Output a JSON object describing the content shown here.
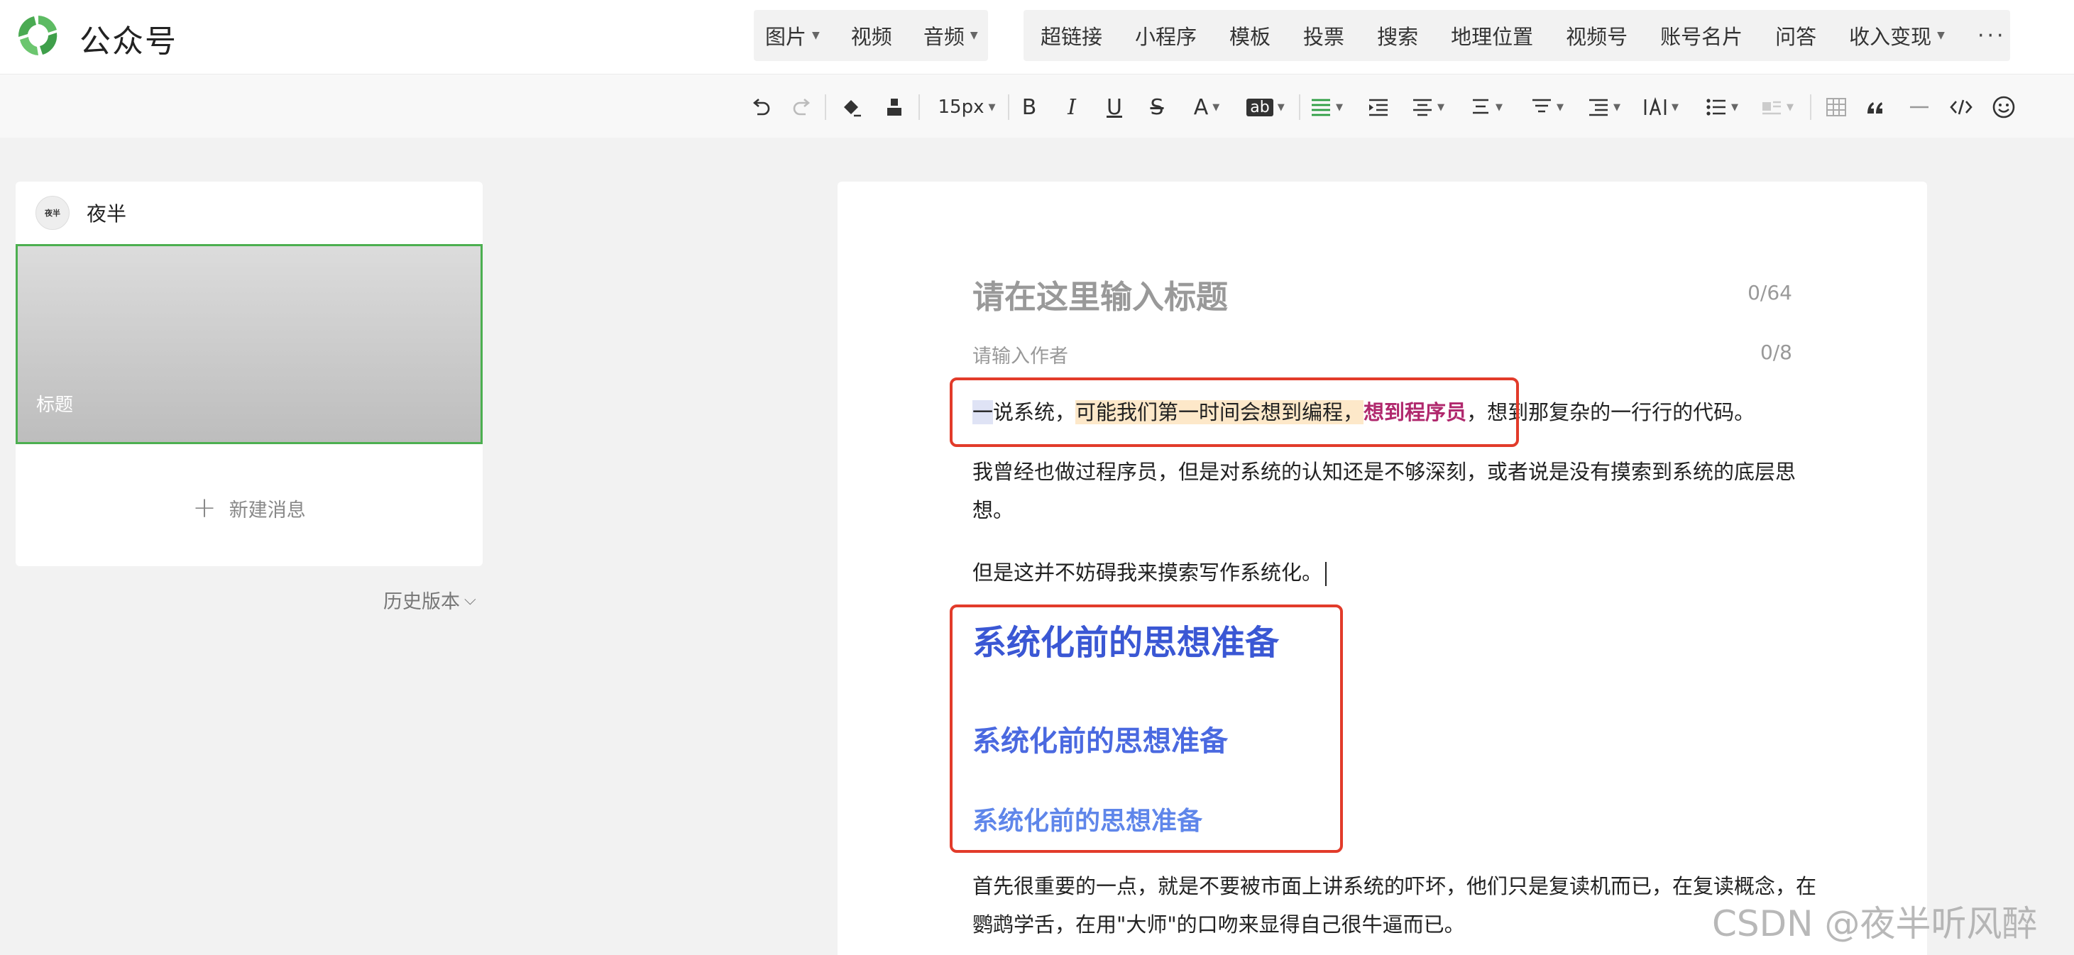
{
  "app": {
    "brand": "公众号"
  },
  "insert_menu": {
    "group1": [
      "图片",
      "视频",
      "音频"
    ],
    "group2": [
      "超链接",
      "小程序",
      "模板",
      "投票",
      "搜索",
      "地理位置",
      "视频号",
      "账号名片",
      "问答",
      "收入变现"
    ],
    "more": "···"
  },
  "toolbar": {
    "font_size": "15px",
    "bold": "B",
    "italic": "I",
    "underline": "U",
    "strike": "S",
    "font_color": "A",
    "bg_color": "ab"
  },
  "account": {
    "name": "夜半",
    "avatar_text": "夜半"
  },
  "cover": {
    "title": "标题"
  },
  "new_message": {
    "label": "新建消息"
  },
  "history": {
    "label": "历史版本"
  },
  "editor": {
    "title_placeholder": "请在这里输入标题",
    "title_count": "0/64",
    "author_placeholder": "请输入作者",
    "author_count": "0/8",
    "p1": {
      "a": "一",
      "b": "说系统，",
      "c": "可能我们第一时间会想到编程，",
      "d": "想到程序员",
      "e": "，想到那复杂的一行行的代码。"
    },
    "p2": "我曾经也做过程序员，但是对系统的认知还是不够深刻，或者说是没有摸索到系统的底层思想。",
    "p3": "但是这并不妨碍我来摸索写作系统化。",
    "h1": "系统化前的思想准备",
    "h2": "系统化前的思想准备",
    "h3": "系统化前的思想准备",
    "p4": "首先很重要的一点，就是不要被市面上讲系统的吓坏，他们只是复读机而已，在复读概念，在鹦鹉学舌，在用\"大师\"的口吻来显得自己很牛逼而已。"
  },
  "watermark": "CSDN @夜半听风醉",
  "colors": {
    "accent_green": "#4caf50",
    "annotation_red": "#e23b2a",
    "heading_blue": "#3a57d4",
    "highlight_pink": "#b0286d"
  }
}
